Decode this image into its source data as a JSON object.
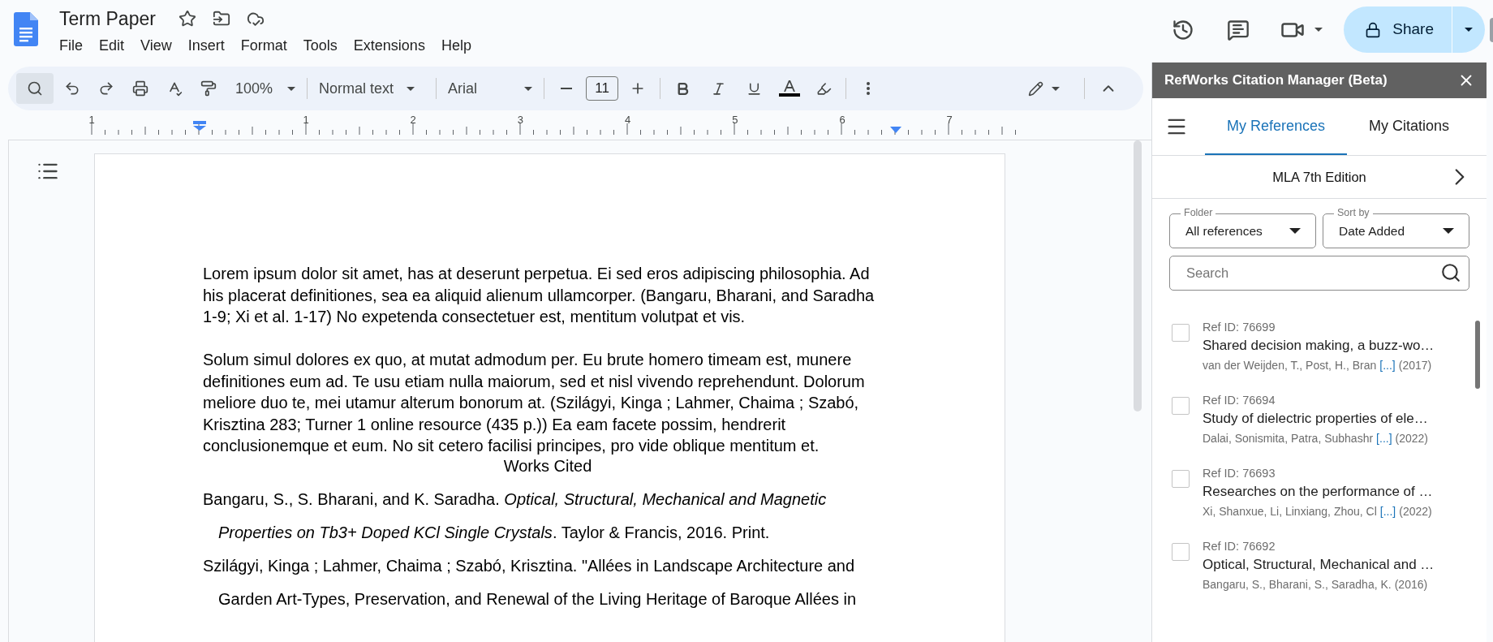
{
  "document": {
    "title": "Term Paper"
  },
  "menu": [
    "File",
    "Edit",
    "View",
    "Insert",
    "Format",
    "Tools",
    "Extensions",
    "Help"
  ],
  "share_button": "Share",
  "toolbar": {
    "zoom": "100%",
    "style": "Normal text",
    "font": "Arial",
    "font_size": "11"
  },
  "ruler": {
    "labels": [
      "1",
      "1",
      "2",
      "3",
      "4",
      "5",
      "6",
      "7"
    ]
  },
  "page": {
    "paragraphs": [
      "Lorem ipsum dolor sit amet, has at deserunt perpetua. Ei sed eros adipiscing philosophia. Ad his placerat definitiones, sea ea aliquid alienum ullamcorper. (Bangaru, Bharani, and Saradha 1-9; Xi et al. 1-17) No expetenda consectetuer est, mentitum volutpat et vis.",
      "Solum simul dolores ex quo, at mutat admodum per. Eu brute homero timeam est, munere definitiones eum ad. Te usu etiam nulla maiorum, sed et nisl vivendo reprehendunt. Dolorum meliore duo te, mei utamur alterum bonorum at. (Szilágyi, Kinga ; Lahmer, Chaima ; Szabó, Krisztina 283; Turner 1 online resource (435 p.)) Ea eam facete possim, hendrerit conclusionemque et eum. No sit cetero facilisi principes, pro vide oblique mentitum et."
    ],
    "heading": "Works Cited",
    "works_cited": [
      "Bangaru, S., S. Bharani, and K. Saradha. *Optical, Structural, Mechanical and Magnetic Properties on Tb3+ Doped KCl Single Crystals*. Taylor & Francis, 2016. Print.",
      "Szilágyi, Kinga ; Lahmer, Chaima ; Szabó, Krisztina. \"Allées in Landscape Architecture and Garden Art-Types, Preservation, and Renewal of the Living Heritage of Baroque Allées in"
    ]
  },
  "sidebar": {
    "title": "RefWorks Citation Manager (Beta)",
    "tabs": [
      {
        "label": "My References",
        "selected": true
      },
      {
        "label": "My Citations",
        "selected": false
      }
    ],
    "citation_style": "MLA 7th Edition",
    "folder": {
      "label": "Folder",
      "value": "All references"
    },
    "sort": {
      "label": "Sort by",
      "value": "Date Added"
    },
    "search": {
      "placeholder": "Search"
    },
    "references": [
      {
        "ref_id": "Ref ID: 76699",
        "title": "Shared decision making, a buzz-wo…",
        "authors": "van der Weijden, T., Post, H., Bran",
        "more": "[...]",
        "year": "(2017)",
        "checked": false
      },
      {
        "ref_id": "Ref ID: 76694",
        "title": "Study of dielectric properties of ele…",
        "authors": "Dalai, Sonismita, Patra, Subhashr",
        "more": "[...]",
        "year": "(2022)",
        "checked": false
      },
      {
        "ref_id": "Ref ID: 76693",
        "title": "Researches on the performance of …",
        "authors": "Xi, Shanxue, Li, Linxiang, Zhou, Cl",
        "more": "[...]",
        "year": "(2022)",
        "checked": false
      },
      {
        "ref_id": "Ref ID: 76692",
        "title": "Optical, Structural, Mechanical and …",
        "authors": "Bangaru, S., Bharani, S., Saradha, K.",
        "year": "(2016)",
        "checked": false
      }
    ]
  }
}
